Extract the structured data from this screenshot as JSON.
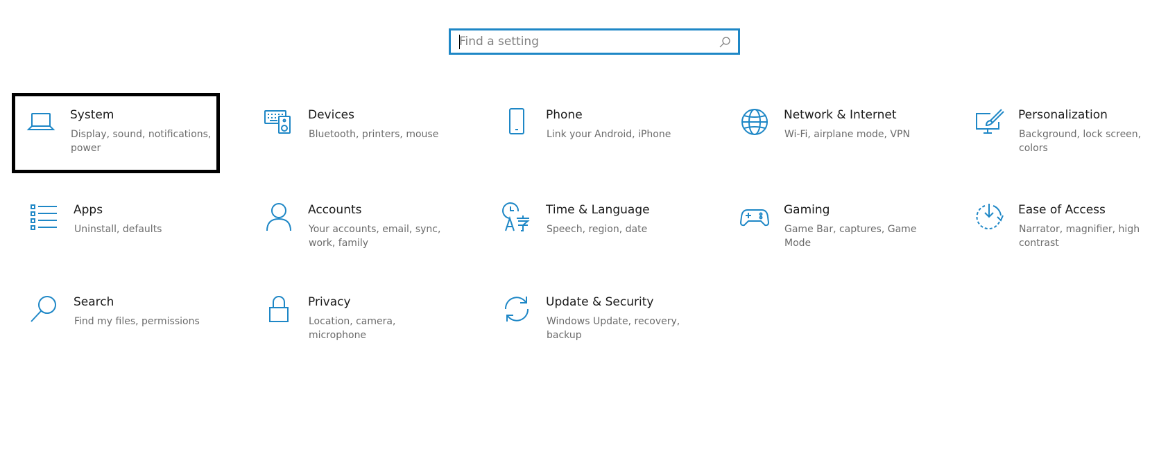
{
  "search": {
    "placeholder": "Find a setting",
    "value": ""
  },
  "accent_color": "#1e87c6",
  "focus_color": "#000000",
  "tiles": [
    {
      "title": "System",
      "desc": "Display, sound, notifications, power",
      "icon": "laptop-icon",
      "focused": true
    },
    {
      "title": "Devices",
      "desc": "Bluetooth, printers, mouse",
      "icon": "keyboard-speaker-icon"
    },
    {
      "title": "Phone",
      "desc": "Link your Android, iPhone",
      "icon": "phone-icon"
    },
    {
      "title": "Network & Internet",
      "desc": "Wi-Fi, airplane mode, VPN",
      "icon": "globe-icon"
    },
    {
      "title": "Personalization",
      "desc": "Background, lock screen, colors",
      "icon": "paint-brush-icon"
    },
    {
      "title": "Apps",
      "desc": "Uninstall, defaults",
      "icon": "apps-list-icon"
    },
    {
      "title": "Accounts",
      "desc": "Your accounts, email, sync, work, family",
      "icon": "person-icon"
    },
    {
      "title": "Time & Language",
      "desc": "Speech, region, date",
      "icon": "time-language-icon"
    },
    {
      "title": "Gaming",
      "desc": "Game Bar, captures, Game Mode",
      "icon": "gamepad-icon"
    },
    {
      "title": "Ease of Access",
      "desc": "Narrator, magnifier, high contrast",
      "icon": "ease-of-access-icon"
    },
    {
      "title": "Search",
      "desc": "Find my files, permissions",
      "icon": "magnifier-icon"
    },
    {
      "title": "Privacy",
      "desc": "Location, camera, microphone",
      "icon": "lock-icon"
    },
    {
      "title": "Update & Security",
      "desc": "Windows Update, recovery, backup",
      "icon": "sync-arrows-icon"
    }
  ]
}
